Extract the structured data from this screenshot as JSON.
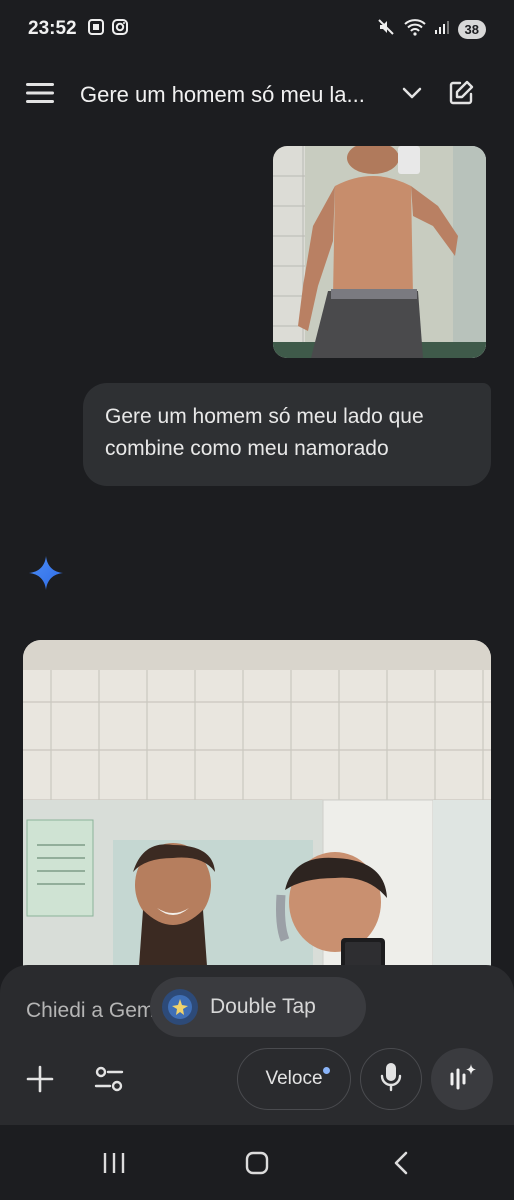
{
  "status_bar": {
    "time": "23:52",
    "battery": "38",
    "icons": [
      "screenshot-icon",
      "instagram-icon",
      "mute-icon",
      "wifi-icon",
      "signal-icon"
    ]
  },
  "header": {
    "title": "Gere um homem só meu la...",
    "icons": [
      "menu-icon",
      "chevron-down-icon",
      "edit-icon"
    ]
  },
  "conversation": {
    "user_message": "Gere um homem só meu lado que combine como meu namorado"
  },
  "input": {
    "placeholder": "Chiedi a Gemini",
    "double_tap_label": "Double Tap",
    "mode_label": "Veloce",
    "accent": "#8ab4f8"
  },
  "nav": {
    "icons": [
      "recent-apps-icon",
      "home-icon",
      "back-icon"
    ]
  }
}
